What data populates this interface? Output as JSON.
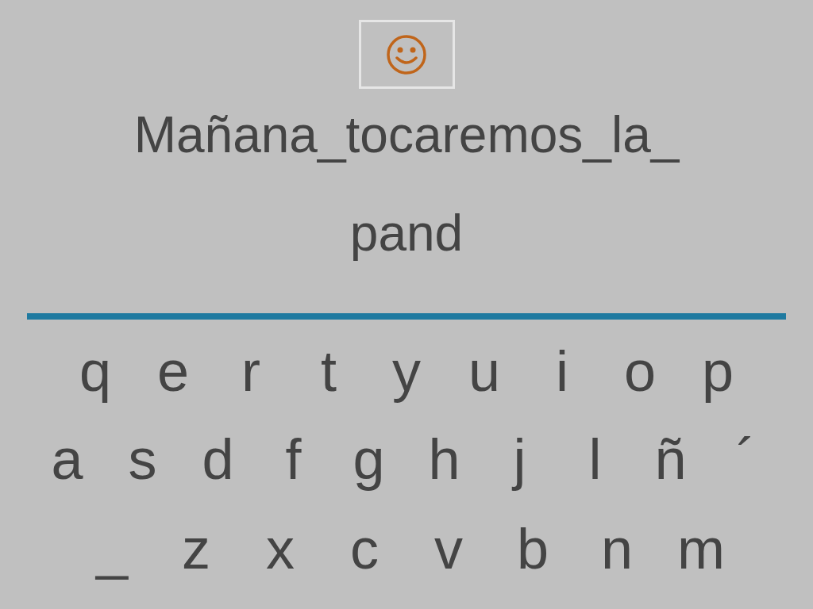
{
  "sentence": "Mañana_tocaremos_la_",
  "answer": "pand",
  "keyboard": {
    "rows": [
      [
        "q",
        "e",
        "r",
        "t",
        "y",
        "u",
        "i",
        "o",
        "p"
      ],
      [
        "a",
        "s",
        "d",
        "f",
        "g",
        "h",
        "j",
        "l",
        "ñ",
        "´"
      ],
      [
        "_",
        "z",
        "x",
        "c",
        "v",
        "b",
        "n",
        "m"
      ]
    ]
  }
}
